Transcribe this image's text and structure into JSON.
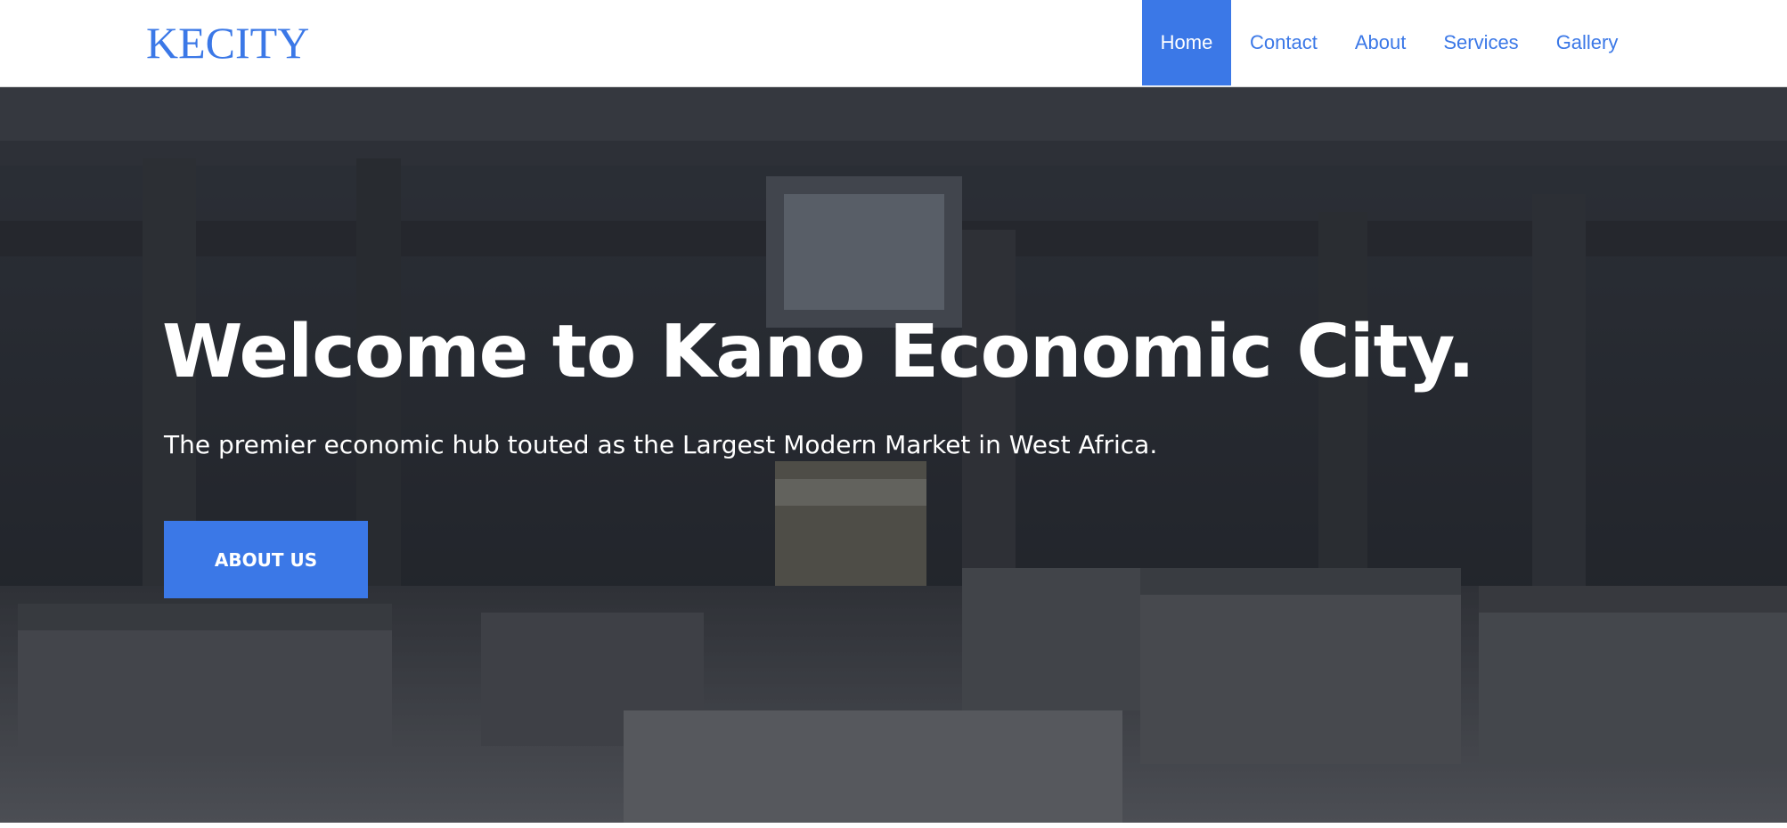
{
  "header": {
    "logo": "KECITY",
    "nav": [
      {
        "label": "Home",
        "active": true
      },
      {
        "label": "Contact",
        "active": false
      },
      {
        "label": "About",
        "active": false
      },
      {
        "label": "Services",
        "active": false
      },
      {
        "label": "Gallery",
        "active": false
      }
    ]
  },
  "hero": {
    "title": "Welcome to Kano Economic City.",
    "subtitle": "The premier economic hub touted as the Largest Modern Market in West Africa.",
    "button_label": "ABOUT US"
  },
  "colors": {
    "accent": "#3b78e7",
    "text_light": "#ffffff",
    "overlay": "#14161c"
  }
}
